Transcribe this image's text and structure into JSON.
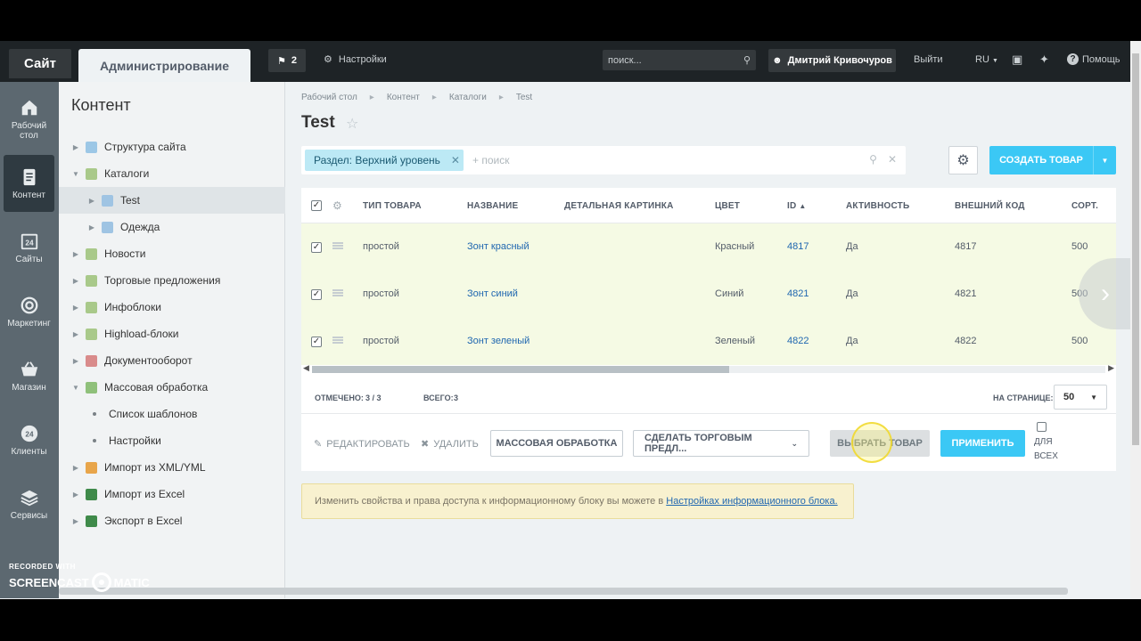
{
  "topbar": {
    "tab_site": "Сайт",
    "tab_admin": "Администрирование",
    "notifications_count": "2",
    "settings": "Настройки",
    "search_placeholder": "поиск...",
    "user_name": "Дмитрий Кривочуров",
    "logout": "Выйти",
    "lang": "RU",
    "help": "Помощь"
  },
  "rail": [
    {
      "label": "Рабочий стол",
      "icon": "home-icon"
    },
    {
      "label": "Контент",
      "icon": "document-icon"
    },
    {
      "label": "Сайты",
      "icon": "calendar-24-icon"
    },
    {
      "label": "Маркетинг",
      "icon": "target-icon"
    },
    {
      "label": "Магазин",
      "icon": "basket-icon"
    },
    {
      "label": "Клиенты",
      "icon": "clients-24-icon"
    },
    {
      "label": "Сервисы",
      "icon": "layers-icon"
    }
  ],
  "sidebar": {
    "title": "Контент",
    "items": [
      {
        "label": "Структура сайта"
      },
      {
        "label": "Каталоги"
      },
      {
        "label": "Test"
      },
      {
        "label": "Одежда"
      },
      {
        "label": "Новости"
      },
      {
        "label": "Торговые предложения"
      },
      {
        "label": "Инфоблоки"
      },
      {
        "label": "Highload-блоки"
      },
      {
        "label": "Документооборот"
      },
      {
        "label": "Массовая обработка"
      },
      {
        "label": "Список шаблонов"
      },
      {
        "label": "Настройки"
      },
      {
        "label": "Импорт из XML/YML"
      },
      {
        "label": "Импорт из Excel"
      },
      {
        "label": "Экспорт в Excel"
      }
    ]
  },
  "breadcrumbs": [
    "Рабочий стол",
    "Контент",
    "Каталоги",
    "Test"
  ],
  "page_title": "Test",
  "filter": {
    "tag": "Раздел: Верхний уровень",
    "placeholder": "+ поиск"
  },
  "create_button": "СОЗДАТЬ ТОВАР",
  "grid": {
    "columns": [
      "ТИП ТОВАРА",
      "НАЗВАНИЕ",
      "ДЕТАЛЬНАЯ КАРТИНКА",
      "ЦВЕТ",
      "ID",
      "АКТИВНОСТЬ",
      "ВНЕШНИЙ КОД",
      "СОРТ."
    ],
    "rows": [
      {
        "type": "простой",
        "name": "Зонт красный",
        "color": "Красный",
        "id": "4817",
        "active": "Да",
        "ext_code": "4817",
        "sort": "500"
      },
      {
        "type": "простой",
        "name": "Зонт синий",
        "color": "Синий",
        "id": "4821",
        "active": "Да",
        "ext_code": "4821",
        "sort": "500"
      },
      {
        "type": "простой",
        "name": "Зонт зеленый",
        "color": "Зеленый",
        "id": "4822",
        "active": "Да",
        "ext_code": "4822",
        "sort": "500"
      }
    ],
    "selected_label": "ОТМЕЧЕНО:",
    "selected_value": "3 / 3",
    "total_label": "ВСЕГО:",
    "total_value": "3",
    "per_page_label": "НА СТРАНИЦЕ:",
    "per_page_value": "50"
  },
  "actions": {
    "edit": "РЕДАКТИРОВАТЬ",
    "delete": "УДАЛИТЬ",
    "mass": "МАССОВАЯ ОБРАБОТКА",
    "make_offers": "СДЕЛАТЬ ТОРГОВЫМ ПРЕДЛ...",
    "select_product": "ВЫБРАТЬ ТОВАР",
    "apply": "ПРИМЕНИТЬ",
    "for_all_1": "ДЛЯ",
    "for_all_2": "ВСЕХ"
  },
  "notice": {
    "text": "Изменить свойства и права доступа к информационному блоку вы можете в",
    "link": "Настройках информационного блока."
  },
  "watermark": {
    "small": "RECORDED WITH",
    "big_left": "SCREENCAST",
    "big_right": "MATIC"
  },
  "colors": {
    "accent": "#3bc8f5",
    "row_selected": "#f5fae4",
    "link": "#2067b0",
    "topbar": "#1e2326"
  }
}
